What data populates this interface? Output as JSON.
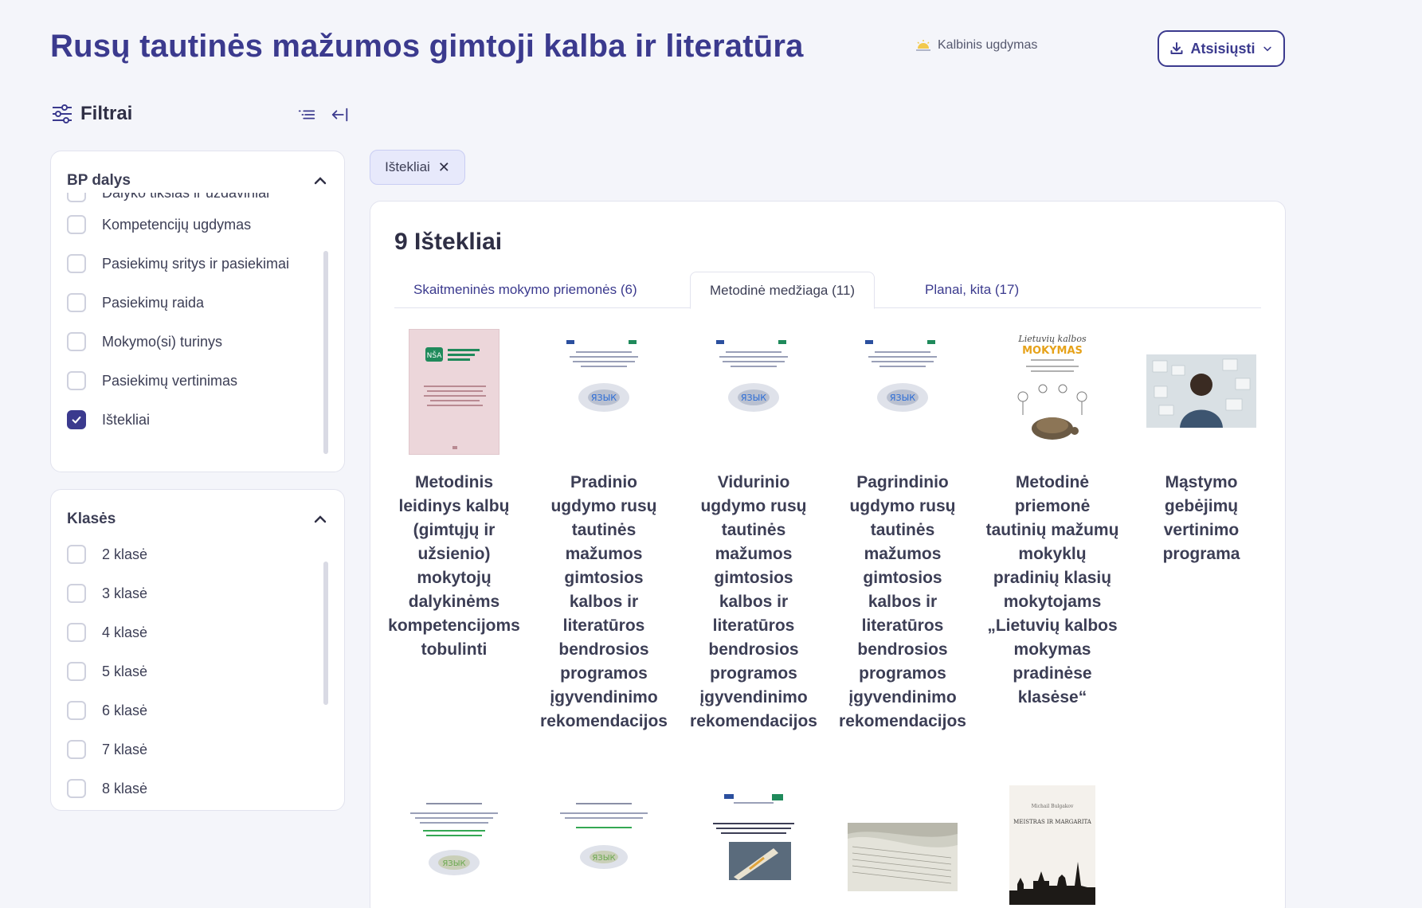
{
  "header": {
    "title": "Rusų tautinės mažumos gimtoji kalba ir literatūra",
    "area_label": "Kalbinis ugdymas",
    "download_label": "Atsisiųsti"
  },
  "filters": {
    "title": "Filtrai",
    "bp_dalys": {
      "title": "BP dalys",
      "items": [
        {
          "label": "Dalyko tikslas ir uždaviniai",
          "checked": false
        },
        {
          "label": "Kompetencijų ugdymas",
          "checked": false
        },
        {
          "label": "Pasiekimų sritys ir pasiekimai",
          "checked": false
        },
        {
          "label": "Pasiekimų raida",
          "checked": false
        },
        {
          "label": "Mokymo(si) turinys",
          "checked": false
        },
        {
          "label": "Pasiekimų vertinimas",
          "checked": false
        },
        {
          "label": "Ištekliai",
          "checked": true
        }
      ]
    },
    "klases": {
      "title": "Klasės",
      "items": [
        {
          "label": "2 klasė",
          "checked": false
        },
        {
          "label": "3 klasė",
          "checked": false
        },
        {
          "label": "4 klasė",
          "checked": false
        },
        {
          "label": "5 klasė",
          "checked": false
        },
        {
          "label": "6 klasė",
          "checked": false
        },
        {
          "label": "7 klasė",
          "checked": false
        },
        {
          "label": "8 klasė",
          "checked": false
        }
      ]
    }
  },
  "active_chip": {
    "label": "Ištekliai"
  },
  "results": {
    "count_title": "9 Ištekliai",
    "tabs": [
      {
        "label": "Skaitmeninės mokymo priemonės (6)",
        "active": false
      },
      {
        "label": "Metodinė medžiaga (11)",
        "active": true
      },
      {
        "label": "Planai, kita (17)",
        "active": false
      }
    ],
    "items": [
      {
        "title": "Metodinis leidinys kalbų (gimtųjų ir užsienio) mokytojų dalykinėms kompetencijoms tobulinti",
        "thumb": "nsa-cover"
      },
      {
        "title": "Pradinio ugdymo rusų tautinės mažumos gimtosios kalbos ir literatūros bendrosios programos įgyvendinimo rekomendacijos",
        "thumb": "word-cloud-doc"
      },
      {
        "title": "Vidurinio ugdymo rusų tautinės mažumos gimtosios kalbos ir literatūros bendrosios programos įgyvendinimo rekomendacijos",
        "thumb": "word-cloud-doc"
      },
      {
        "title": "Pagrindinio ugdymo rusų tautinės mažumos gimtosios kalbos ir literatūros bendrosios programos įgyvendinimo rekomendacijos",
        "thumb": "word-cloud-doc"
      },
      {
        "title": "Metodinė priemonė tautinių mažumų mokyklų pradinių klasių mokytojams „Lietuvių kalbos mokymas pradinėse klasėse“",
        "thumb": "turtle-cover",
        "cover_text": {
          "line1": "Lietuvių kalbos",
          "line2": "MOKYMAS"
        }
      },
      {
        "title": "Mąstymo gebėjimų vertinimo programa",
        "thumb": "person-photo"
      }
    ],
    "second_row_thumbs": [
      {
        "thumb": "word-cloud-doc"
      },
      {
        "thumb": "word-cloud-doc"
      },
      {
        "thumb": "writing-hand-doc"
      },
      {
        "thumb": "book-pages-photo"
      },
      {
        "thumb": "master-margarita-cover",
        "cover_text": {
          "author": "Michail Bulgakov",
          "title": "MEISTRAS IR MARGARITA"
        }
      }
    ]
  },
  "colors": {
    "accent": "#3b3a8e",
    "checkbox_checked": "#3b3a8e",
    "chip_bg": "#e7e9fb",
    "background": "#f4f5fa"
  }
}
